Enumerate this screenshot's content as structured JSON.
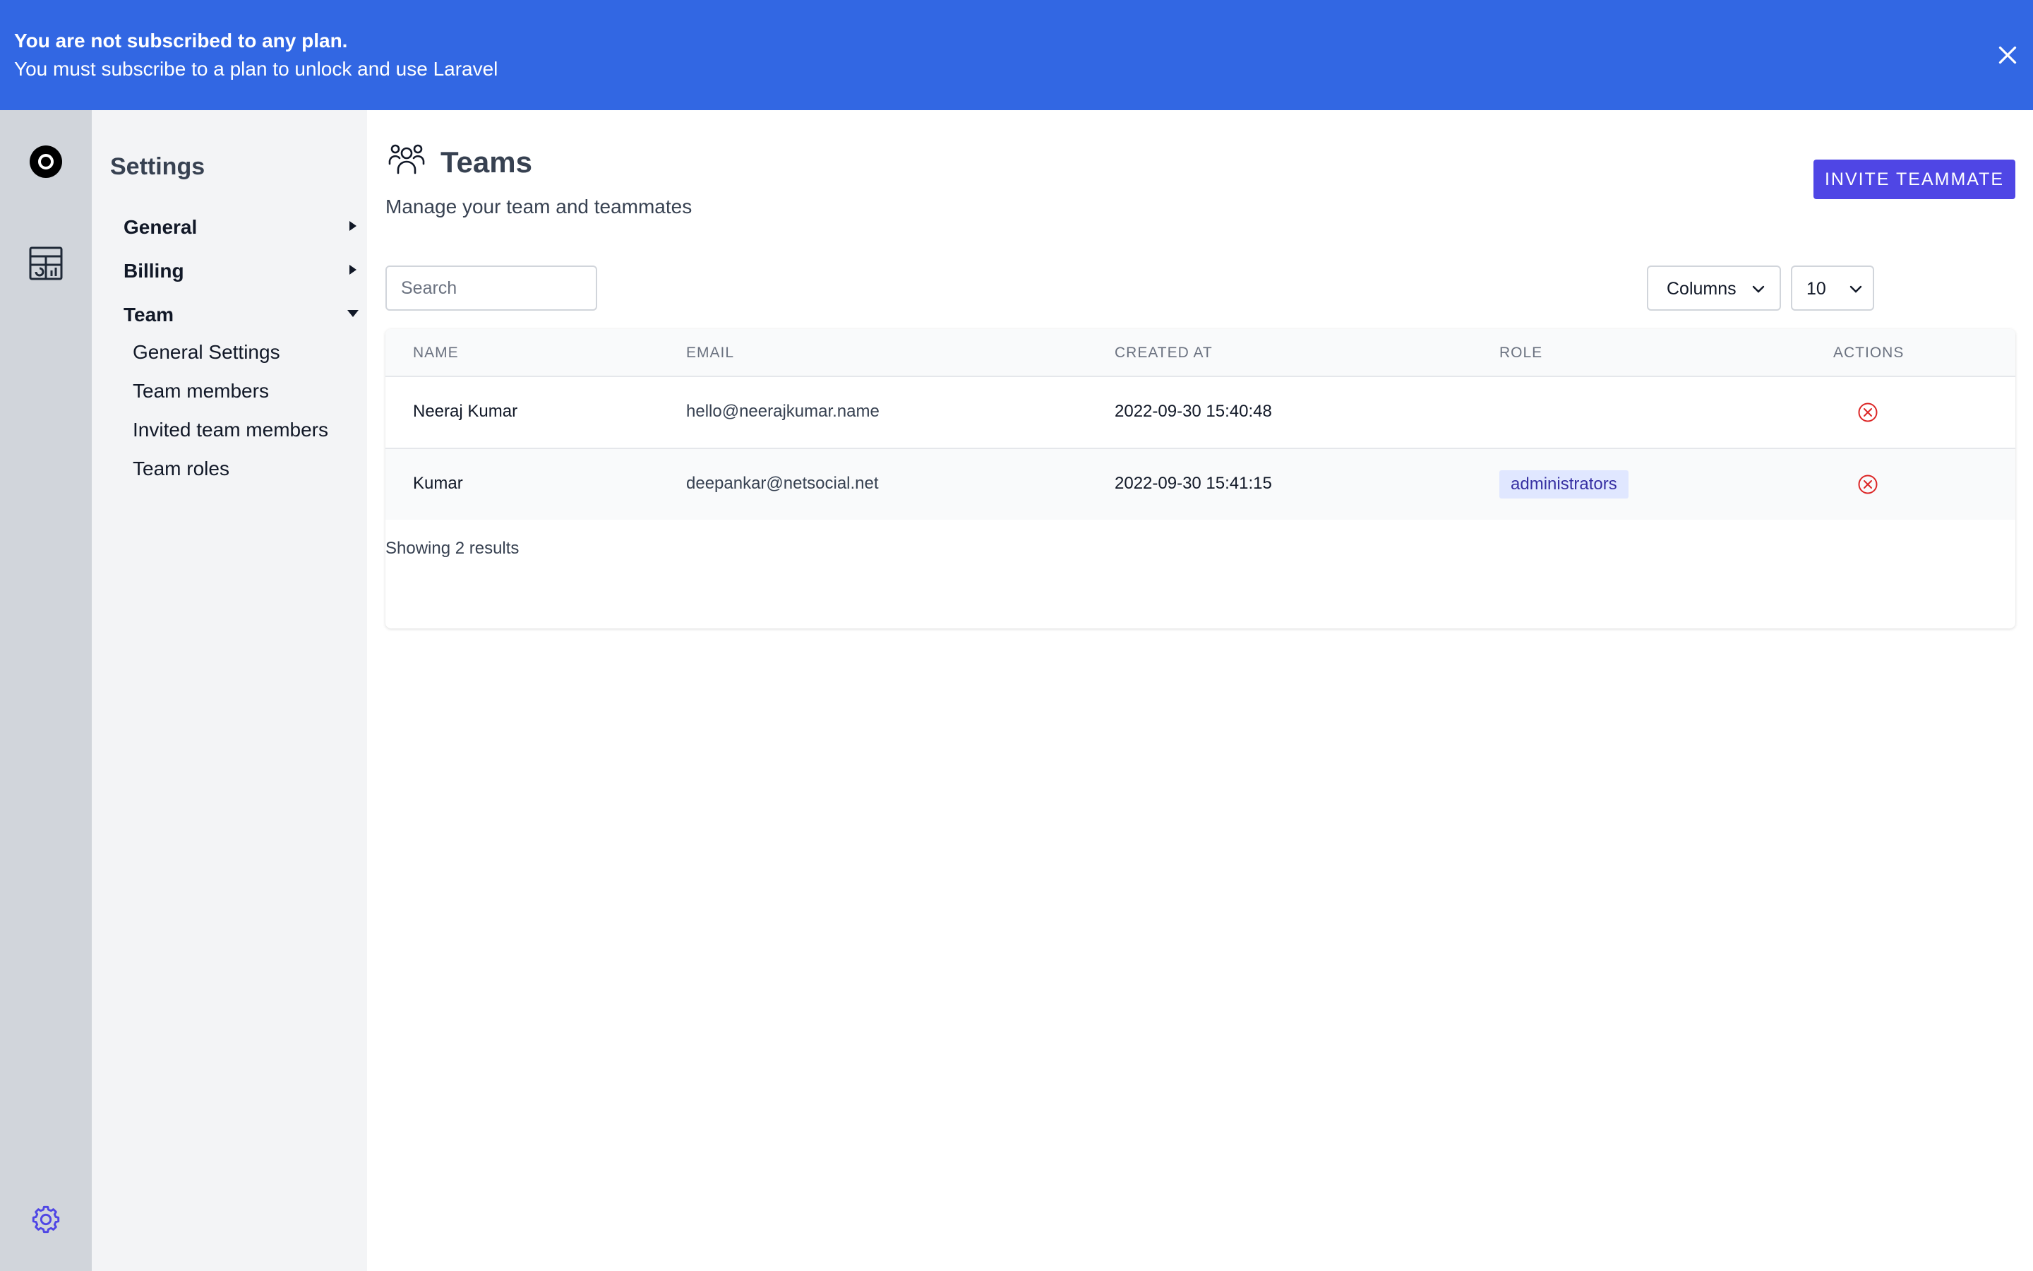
{
  "banner": {
    "title": "You are not subscribed to any plan.",
    "message": "You must subscribe to a plan to unlock and use Laravel",
    "background": "#3267e3"
  },
  "rail": {
    "icons": [
      "app-logo-icon",
      "dashboard-icon",
      "settings-gear-icon"
    ]
  },
  "sidebar": {
    "title": "Settings",
    "sections": [
      {
        "label": "General",
        "state": "collapsed"
      },
      {
        "label": "Billing",
        "state": "collapsed"
      },
      {
        "label": "Team",
        "state": "expanded"
      }
    ],
    "team_items": [
      {
        "label": "General Settings"
      },
      {
        "label": "Team members"
      },
      {
        "label": "Invited team members"
      },
      {
        "label": "Team roles"
      }
    ]
  },
  "page": {
    "title": "Teams",
    "subtitle": "Manage your team and teammates",
    "invite_label": "INVITE TEAMMATE",
    "accent": "#4f46e5"
  },
  "toolbar": {
    "search_placeholder": "Search",
    "columns_label": "Columns",
    "per_page": "10"
  },
  "table": {
    "headers": [
      "NAME",
      "EMAIL",
      "CREATED AT",
      "ROLE",
      "ACTIONS"
    ],
    "rows": [
      {
        "name": "Neeraj Kumar",
        "email": "hello@neerajkumar.name",
        "created_at": "2022-09-30 15:40:48",
        "role": ""
      },
      {
        "name": "Kumar",
        "email": "deepankar@netsocial.net",
        "created_at": "2022-09-30 15:41:15",
        "role": "administrators"
      }
    ]
  },
  "footer": {
    "results_text": "Showing 2 results"
  }
}
